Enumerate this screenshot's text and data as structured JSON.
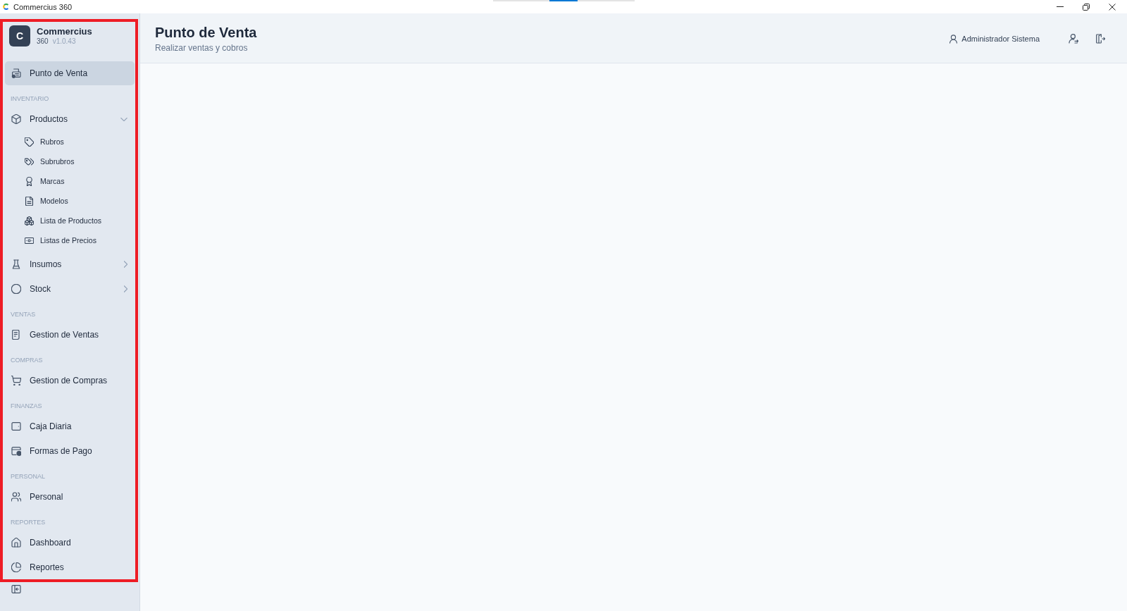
{
  "window": {
    "title": "Commercius 360"
  },
  "sidebar": {
    "highlighted": true,
    "brand": {
      "logo": "C",
      "name": "Commercius",
      "edition": "360",
      "version": "v1.0.43"
    },
    "sections": [
      {
        "items": [
          {
            "label": "Punto de Venta",
            "selected": true
          }
        ]
      },
      {
        "heading": "INVENTARIO",
        "items": [
          {
            "label": "Productos",
            "selected": false,
            "expanded": true,
            "children": [
              {
                "label": "Rubros",
                "selected": false
              },
              {
                "label": "Subrubros",
                "selected": false
              },
              {
                "label": "Marcas",
                "selected": false
              },
              {
                "label": "Modelos",
                "selected": false
              },
              {
                "label": "Lista de Productos",
                "selected": false
              },
              {
                "label": "Listas de Precios",
                "selected": false
              }
            ]
          },
          {
            "label": "Insumos",
            "selected": false,
            "expanded": false
          },
          {
            "label": "Stock",
            "selected": false,
            "expanded": false
          }
        ]
      },
      {
        "heading": "VENTAS",
        "items": [
          {
            "label": "Gestion de Ventas",
            "selected": false
          }
        ]
      },
      {
        "heading": "COMPRAS",
        "items": [
          {
            "label": "Gestion de Compras",
            "selected": false
          }
        ]
      },
      {
        "heading": "FINANZAS",
        "items": [
          {
            "label": "Caja Diaria",
            "selected": false
          },
          {
            "label": "Formas de Pago",
            "selected": false
          }
        ]
      },
      {
        "heading": "PERSONAL",
        "items": [
          {
            "label": "Personal",
            "selected": false
          }
        ]
      },
      {
        "heading": "REPORTES",
        "items": [
          {
            "label": "Dashboard",
            "selected": false
          },
          {
            "label": "Reportes",
            "selected": false
          }
        ]
      }
    ]
  },
  "header": {
    "title": "Punto de Venta",
    "subtitle": "Realizar ventas y cobros",
    "user": "Administrador Sistema"
  }
}
